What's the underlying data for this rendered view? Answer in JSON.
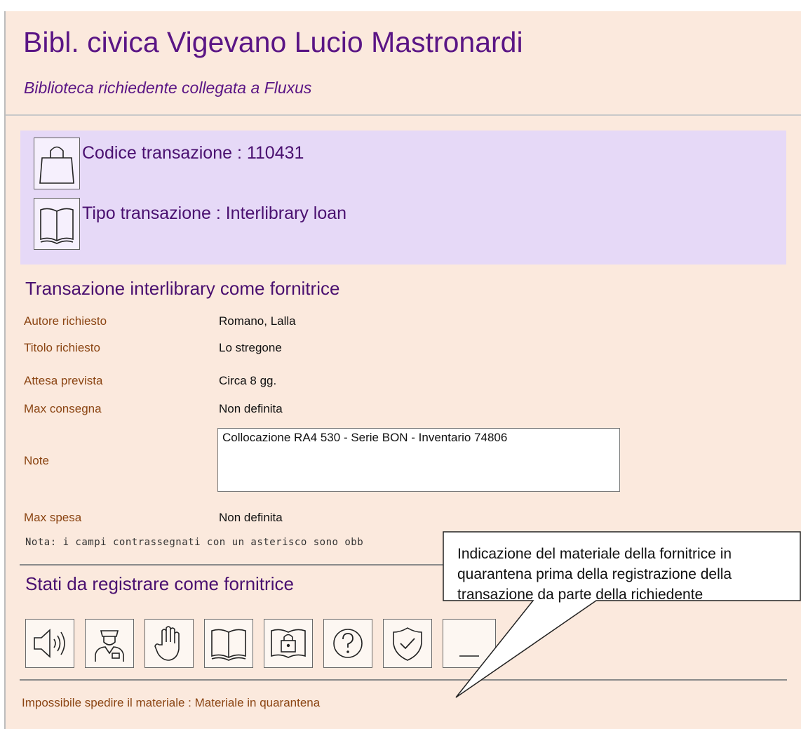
{
  "header": {
    "title": "Bibl. civica Vigevano Lucio Mastronardi",
    "subtitle": "Biblioteca richiedente collegata a Fluxus"
  },
  "transaction": {
    "code_label": "Codice transazione : 110431",
    "type_label": "Tipo transazione : Interlibrary loan"
  },
  "details": {
    "section_title": "Transazione interlibrary come fornitrice",
    "fields": [
      {
        "label": "Autore richiesto",
        "value": "Romano, Lalla"
      },
      {
        "label": "Titolo richiesto",
        "value": "Lo stregone"
      },
      {
        "label": "Attesa prevista",
        "value": "Circa 8 gg."
      },
      {
        "label": "Max consegna",
        "value": "Non definita"
      },
      {
        "label": "Note",
        "value": "Collocazione RA4 530 - Serie BON - Inventario 74806"
      },
      {
        "label": "Max spesa",
        "value": "Non definita"
      }
    ],
    "footnote": "Nota: i campi contrassegnati con un asterisco sono obb"
  },
  "status": {
    "section_title": "Stati da registrare come fornitrice",
    "buttons": [
      "speaker-icon",
      "courier-icon",
      "hand-icon",
      "open-book-icon",
      "locked-book-icon",
      "question-icon",
      "shield-check-icon",
      "partial-icon"
    ]
  },
  "message": "Impossibile spedire il materiale : Materiale in quarantena",
  "callout": {
    "text": "Indicazione del materiale della fornitrice in quarantena prima della registrazione della transazione da parte della richiedente"
  },
  "colors": {
    "page_bg": "#fbe9dd",
    "transaction_bg": "#e6d9f7",
    "title": "#5a1585",
    "label": "#8b4513"
  }
}
